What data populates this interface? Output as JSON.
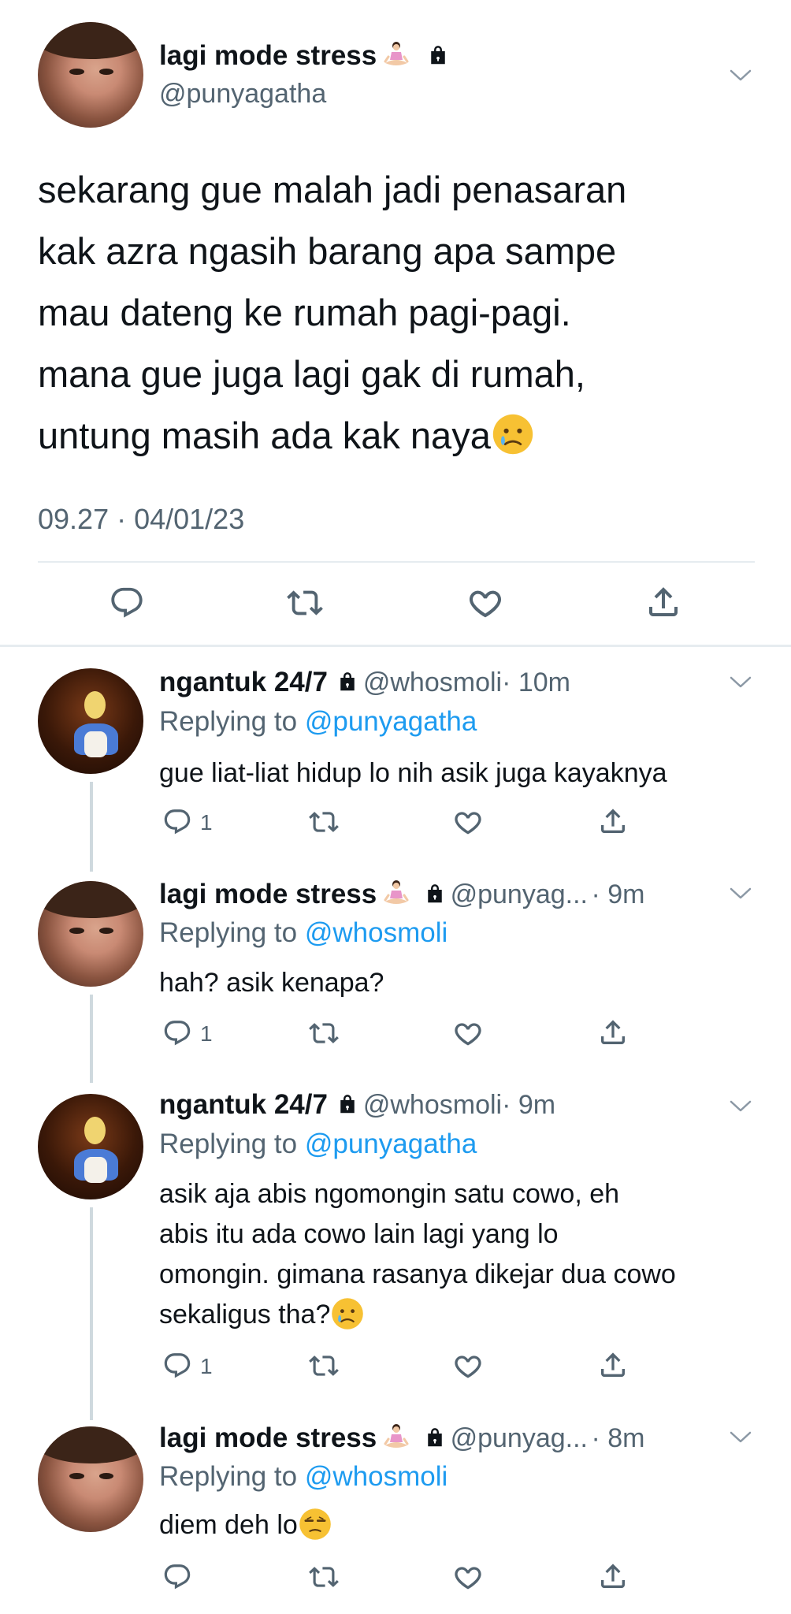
{
  "main_tweet": {
    "display_name": "lagi mode stress",
    "handle": "@punyagatha",
    "text_lines": [
      "sekarang gue malah jadi penasaran",
      "kak azra ngasih barang apa sampe",
      "mau dateng ke rumah pagi-pagi.",
      "mana gue juga lagi gak di rumah,",
      "untung masih ada kak naya"
    ],
    "timestamp": "09.27 · 04/01/23"
  },
  "replies": [
    {
      "display_name": "ngantuk 24/7",
      "handle": "@whosmoli",
      "time": "· 10m",
      "replying_prefix": "Replying to",
      "replying_to": "@punyagatha",
      "text_lines": [
        "gue liat-liat hidup lo nih asik juga kayaknya"
      ],
      "reply_count": "1"
    },
    {
      "display_name": "lagi mode stress",
      "handle": "@punyag...",
      "time": "· 9m",
      "replying_prefix": "Replying to",
      "replying_to": "@whosmoli",
      "text_lines": [
        "hah? asik kenapa?"
      ],
      "reply_count": "1"
    },
    {
      "display_name": "ngantuk 24/7",
      "handle": "@whosmoli",
      "time": "· 9m",
      "replying_prefix": "Replying to",
      "replying_to": "@punyagatha",
      "text_lines": [
        "asik aja abis ngomongin satu cowo, eh",
        "abis itu ada cowo lain lagi yang lo",
        "omongin. gimana rasanya dikejar dua cowo",
        "sekaligus tha?"
      ],
      "reply_count": "1"
    },
    {
      "display_name": "lagi mode stress",
      "handle": "@punyag...",
      "time": "· 8m",
      "replying_prefix": "Replying to",
      "replying_to": "@whosmoli",
      "text_lines": [
        "diem deh lo"
      ],
      "reply_count": ""
    }
  ],
  "icons": {
    "reply": "reply-icon",
    "retweet": "retweet-icon",
    "like": "heart-icon",
    "share": "share-icon",
    "lock": "lock-icon",
    "more": "chevron-down-icon"
  },
  "colors": {
    "text": "#0f1419",
    "muted": "#536471",
    "link": "#1d9bf0",
    "divider": "#e6ecf0"
  }
}
